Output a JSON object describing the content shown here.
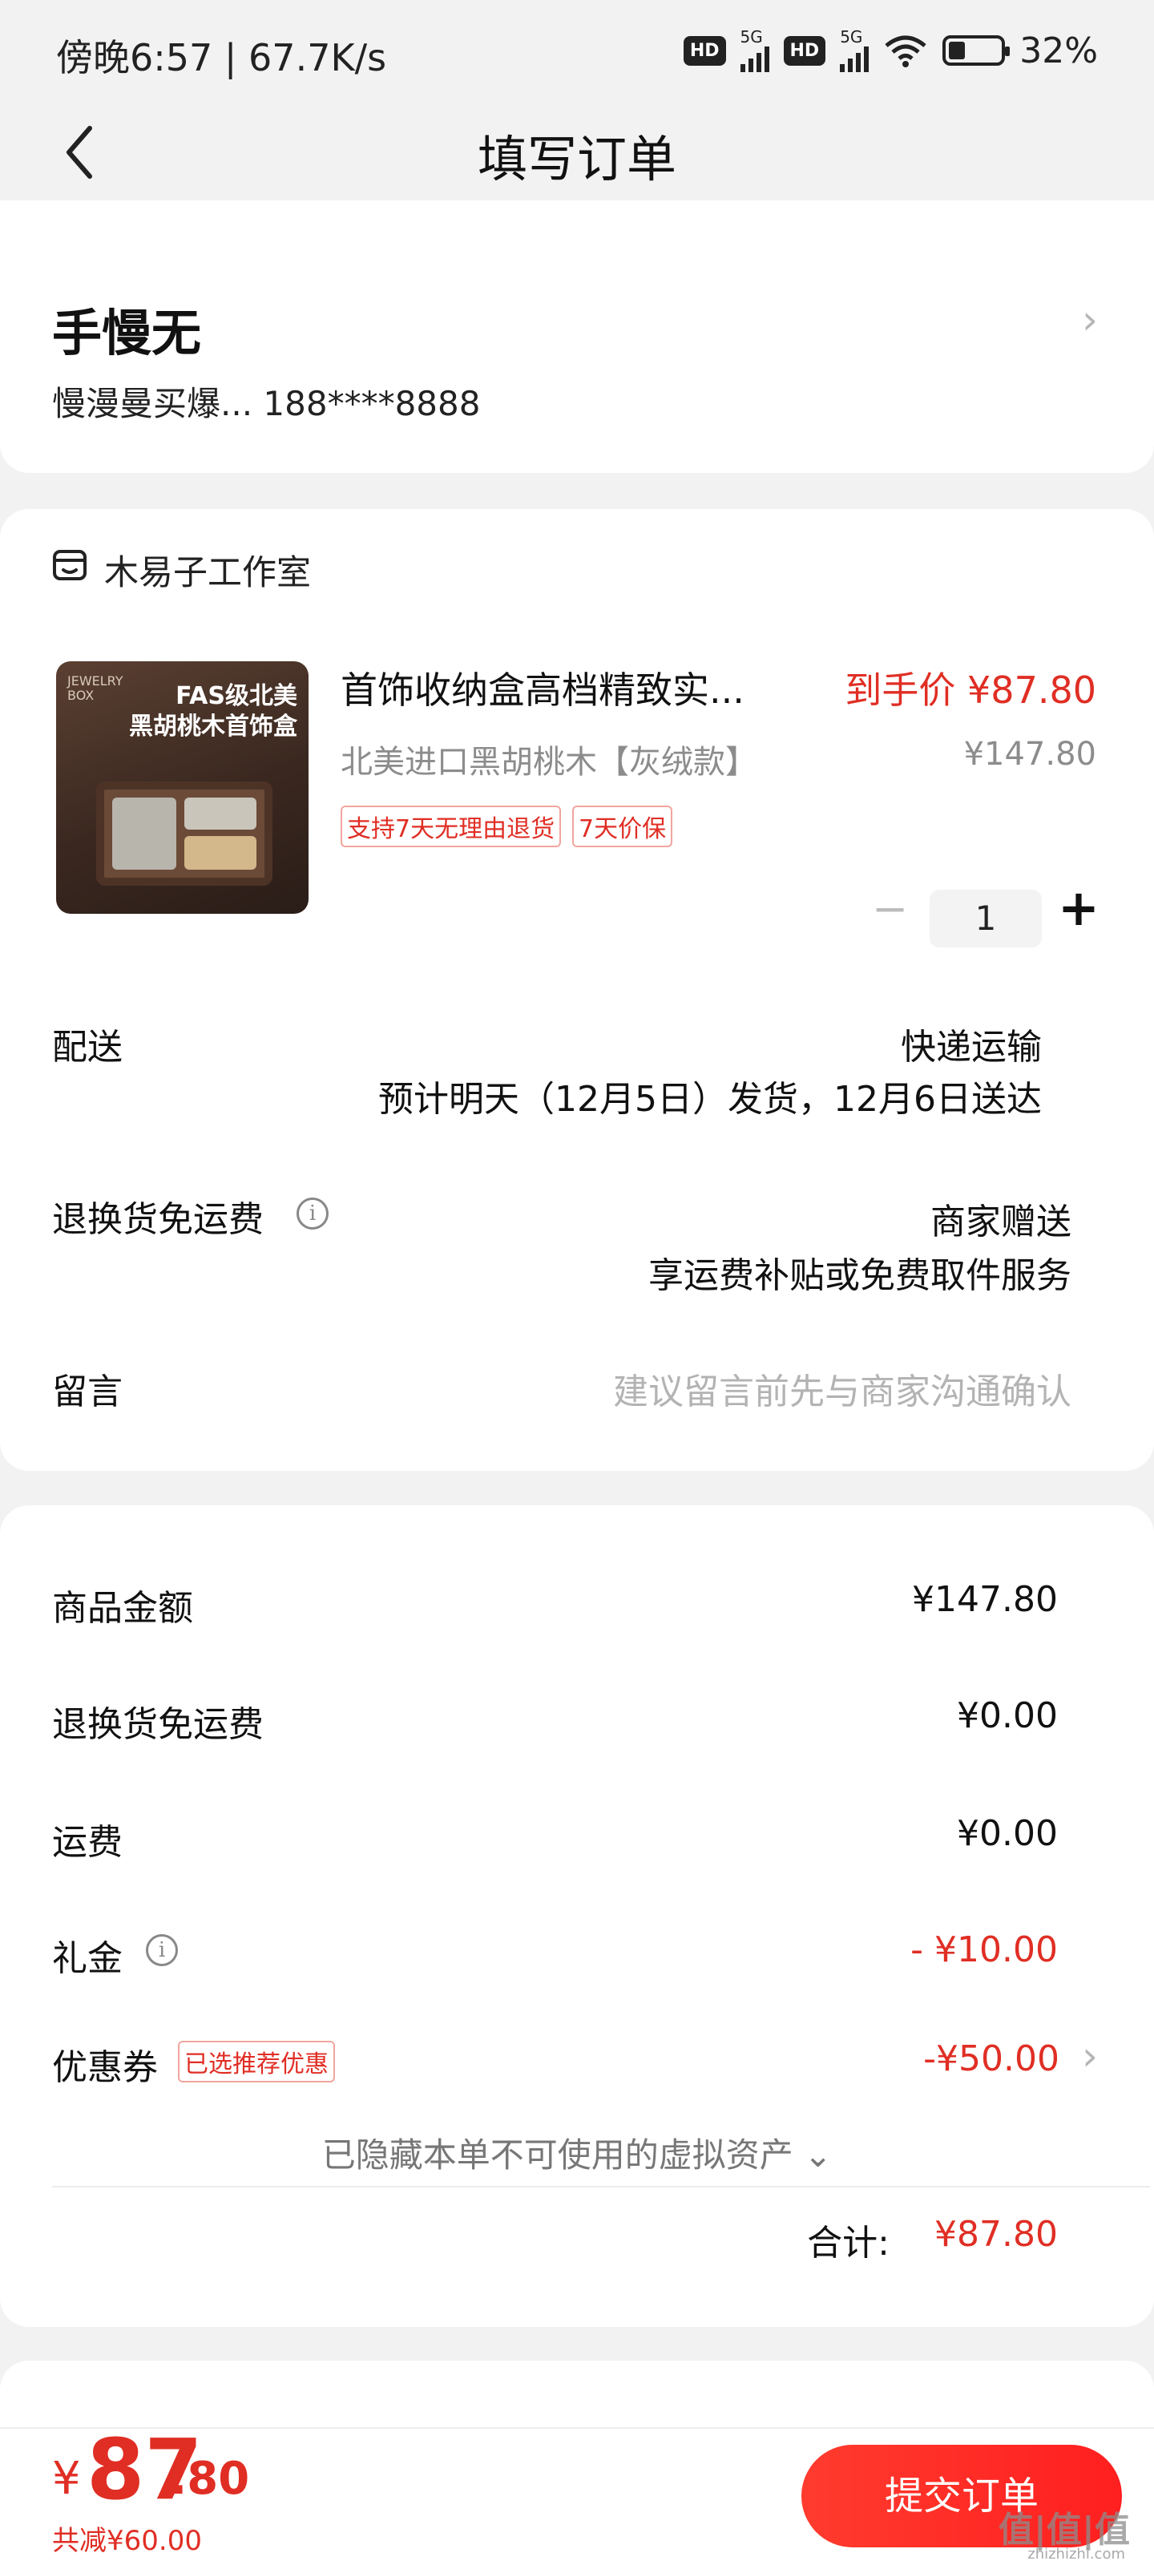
{
  "status_bar": {
    "left_text": "傍晚6:57 | 67.7K/s",
    "hd": "HD",
    "net_5g": "5G",
    "battery": "32%"
  },
  "nav": {
    "title": "填写订单"
  },
  "address": {
    "name": "手慢无",
    "detail": "慢漫曼买爆...  188****8888"
  },
  "shop": {
    "name": "木易子工作室"
  },
  "product": {
    "image_caption_line1": "FAS级北美",
    "image_caption_line2": "黑胡桃木首饰盒",
    "image_brand": "JEWELRY BOX",
    "title": "首饰收纳盒高档精致实...",
    "price_label": "到手价 ¥87.80",
    "spec": "北美进口黑胡桃木【灰绒款】",
    "original_price": "¥147.80",
    "tags": [
      "支持7天无理由退货",
      "7天价保"
    ],
    "quantity": "1",
    "minus": "−",
    "plus": "+"
  },
  "delivery": {
    "label": "配送",
    "method": "快递运输",
    "eta": "预计明天（12月5日）发货，12月6日送达"
  },
  "return_shipping": {
    "label": "退换货免运费",
    "line1": "商家赠送",
    "line2": "享运费补贴或免费取件服务"
  },
  "message": {
    "label": "留言",
    "placeholder": "建议留言前先与商家沟通确认"
  },
  "summary": {
    "goods_label": "商品金额",
    "goods_value": "¥147.80",
    "return_label": "退换货免运费",
    "return_value": "¥0.00",
    "freight_label": "运费",
    "freight_value": "¥0.00",
    "gift_label": "礼金",
    "gift_value": "- ¥10.00",
    "coupon_label": "优惠券",
    "coupon_tag": "已选推荐优惠",
    "coupon_value": "-¥50.00",
    "hidden_assets": "已隐藏本单不可使用的虚拟资产 ⌄",
    "total_label": "合计:",
    "total_value": "¥87.80"
  },
  "footer": {
    "currency": "¥",
    "amount_int": "87",
    "amount_dec": ".80",
    "saved": "共减¥60.00",
    "submit": "提交订单",
    "watermark": "值|值|值",
    "watermark_sub": "zhizhizhi.com"
  },
  "colors": {
    "accent": "#e02e24",
    "background": "#f2f2f2"
  }
}
